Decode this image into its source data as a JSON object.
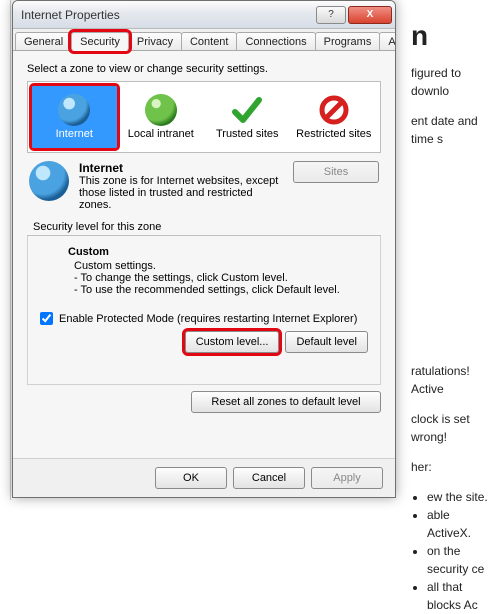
{
  "title": "Internet Properties",
  "window_buttons": {
    "help": "?",
    "close": "X"
  },
  "tabs": [
    "General",
    "Security",
    "Privacy",
    "Content",
    "Connections",
    "Programs",
    "Advanced"
  ],
  "active_tab_index": 1,
  "zone_instruction": "Select a zone to view or change security settings.",
  "zones": [
    {
      "label": "Internet",
      "icon": "globe-icon",
      "selected": true
    },
    {
      "label": "Local intranet",
      "icon": "globe2-icon",
      "selected": false
    },
    {
      "label": "Trusted sites",
      "icon": "check-icon",
      "selected": false
    },
    {
      "label": "Restricted sites",
      "icon": "no-icon",
      "selected": false
    }
  ],
  "zone_detail": {
    "name": "Internet",
    "description": "This zone is for Internet websites, except those listed in trusted and restricted zones.",
    "sites_button": "Sites"
  },
  "security_level_label": "Security level for this zone",
  "custom": {
    "title": "Custom",
    "subtitle": "Custom settings.",
    "line1": "- To change the settings, click Custom level.",
    "line2": "- To use the recommended settings, click Default level."
  },
  "protected_mode": {
    "checked": true,
    "label": "Enable Protected Mode (requires restarting Internet Explorer)"
  },
  "buttons": {
    "custom_level": "Custom level...",
    "default_level": "Default level",
    "reset_all": "Reset all zones to default level",
    "ok": "OK",
    "cancel": "Cancel",
    "apply": "Apply"
  },
  "background": {
    "heading_fragment": "n",
    "p1": "figured to downlo",
    "p2": "ent date and time s",
    "p3": "ratulations! Active",
    "p4": "clock is set wrong!",
    "p5": "her:",
    "li1": "ew the site.",
    "li2": "able ActiveX.",
    "li3": "on the security ce",
    "li4": "all that blocks Ac"
  }
}
